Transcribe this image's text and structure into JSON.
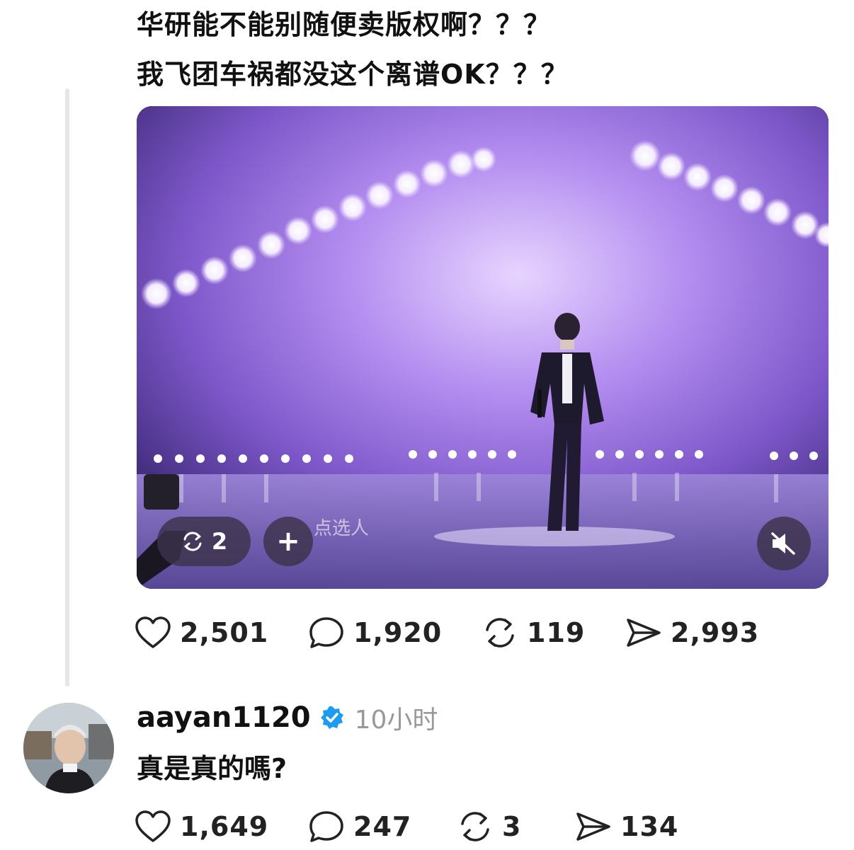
{
  "post": {
    "text_line1": "华研能不能别随便卖版权啊？？？",
    "text_line2": "我飞团车祸都没这个离谱OK？？？",
    "media": {
      "repost_count": "2",
      "add_symbol": "+",
      "muted_icon": "speaker-muted-icon",
      "overlay_caption": "点选人"
    },
    "actions": {
      "likes": "2,501",
      "replies": "1,920",
      "reposts": "119",
      "shares": "2,993"
    }
  },
  "reply": {
    "username": "aayan1120",
    "time": "10小时",
    "text": "真是真的嗎?",
    "actions": {
      "likes": "1,649",
      "replies": "247",
      "reposts": "3",
      "shares": "134"
    }
  },
  "colors": {
    "verified": "#1d9bf0",
    "stage_purple": "#b48ef0",
    "text": "#111111",
    "muted_text": "#999999"
  }
}
